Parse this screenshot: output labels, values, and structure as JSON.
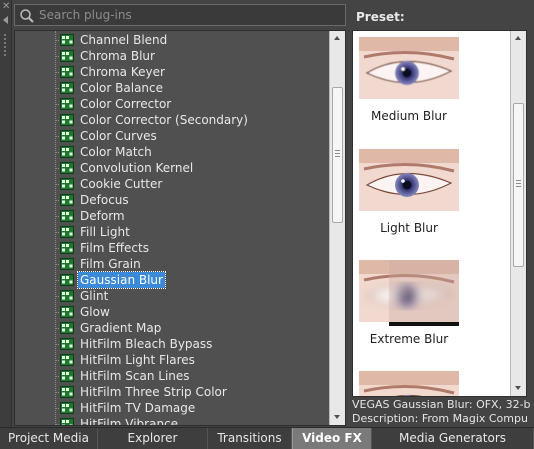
{
  "search": {
    "placeholder": "Search plug-ins"
  },
  "tree": {
    "items": [
      {
        "label": "Channel Blend"
      },
      {
        "label": "Chroma Blur"
      },
      {
        "label": "Chroma Keyer"
      },
      {
        "label": "Color Balance"
      },
      {
        "label": "Color Corrector"
      },
      {
        "label": "Color Corrector (Secondary)"
      },
      {
        "label": "Color Curves"
      },
      {
        "label": "Color Match"
      },
      {
        "label": "Convolution Kernel"
      },
      {
        "label": "Cookie Cutter"
      },
      {
        "label": "Defocus"
      },
      {
        "label": "Deform"
      },
      {
        "label": "Fill Light"
      },
      {
        "label": "Film Effects"
      },
      {
        "label": "Film Grain"
      },
      {
        "label": "Gaussian Blur",
        "selected": true
      },
      {
        "label": "Glint"
      },
      {
        "label": "Glow"
      },
      {
        "label": "Gradient Map"
      },
      {
        "label": "HitFilm Bleach Bypass"
      },
      {
        "label": "HitFilm Light Flares"
      },
      {
        "label": "HitFilm Scan Lines"
      },
      {
        "label": "HitFilm Three Strip Color"
      },
      {
        "label": "HitFilm TV Damage"
      },
      {
        "label": "HitFilm Vibrance"
      }
    ]
  },
  "preset": {
    "label": "Preset:",
    "items": [
      {
        "caption": "Medium Blur"
      },
      {
        "caption": "Light Blur"
      },
      {
        "caption": "Extreme Blur"
      },
      {
        "caption": ""
      }
    ]
  },
  "description": {
    "line1": "VEGAS Gaussian Blur: OFX, 32-b",
    "line2": "Description: From Magix Compu"
  },
  "tabs": [
    {
      "label": "Project Media"
    },
    {
      "label": "Explorer"
    },
    {
      "label": "Transitions"
    },
    {
      "label": "Video FX",
      "active": true
    },
    {
      "label": "Media Generators"
    }
  ],
  "colors": {
    "panel_bg": "#505050",
    "selection": "#3a8ad8",
    "active_tab": "#7a7a7a"
  }
}
